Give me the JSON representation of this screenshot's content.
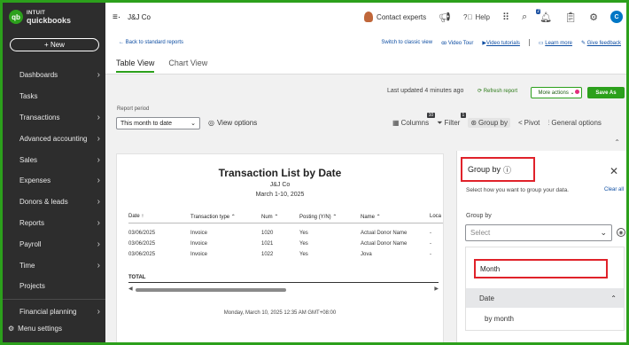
{
  "logo": {
    "badge": "qb",
    "line1": "INTUIT",
    "line2": "quickbooks"
  },
  "new_button": "+ New",
  "sidebar": {
    "items": [
      {
        "label": "Dashboards",
        "chev": true
      },
      {
        "label": "Tasks",
        "chev": false
      },
      {
        "label": "Transactions",
        "chev": true
      },
      {
        "label": "Advanced accounting",
        "chev": true
      },
      {
        "label": "Sales",
        "chev": true
      },
      {
        "label": "Expenses",
        "chev": true
      },
      {
        "label": "Donors & leads",
        "chev": true
      },
      {
        "label": "Reports",
        "chev": true
      },
      {
        "label": "Payroll",
        "chev": true
      },
      {
        "label": "Time",
        "chev": true
      },
      {
        "label": "Projects",
        "chev": false
      },
      {
        "label": "Financial planning",
        "chev": true
      }
    ],
    "menu_settings": "Menu settings"
  },
  "topbar": {
    "company": "J&J Co",
    "contact": "Contact experts",
    "help": "Help",
    "notif_count": "2",
    "user_initial": "C"
  },
  "links": {
    "back": "← Back to standard reports",
    "classic": "Switch to classic view",
    "video_tour": "Video Tour",
    "video_tutorials": "Video tutorials",
    "learn_more": "Learn more",
    "give_feedback": "Give feedback"
  },
  "tabs": [
    "Table View",
    "Chart View"
  ],
  "toolbar": {
    "updated": "Last updated 4 minutes ago",
    "refresh": "Refresh report",
    "more_actions": "More actions ⌄",
    "save_as": "Save As",
    "report_period_label": "Report period",
    "report_period_value": "This month to date",
    "view_options": "View options",
    "columns": "Columns",
    "columns_count": "10",
    "filter": "Filter",
    "filter_count": "1",
    "group_by": "Group by",
    "pivot": "Pivot",
    "general_options": "General options"
  },
  "report": {
    "title": "Transaction List by Date",
    "company": "J&J Co",
    "date_range": "March 1-10, 2025",
    "columns": [
      "Date ↑",
      "Transaction type ⌃",
      "Num ⌃",
      "Posting (Y/N) ⌃",
      "Name ⌃",
      "Loca"
    ],
    "rows": [
      [
        "03/06/2025",
        "Invoice",
        "1020",
        "Yes",
        "Actual Donor Name",
        "-"
      ],
      [
        "03/06/2025",
        "Invoice",
        "1021",
        "Yes",
        "Actual Donor Name",
        "-"
      ],
      [
        "03/06/2025",
        "Invoice",
        "1022",
        "Yes",
        "Jova",
        "-"
      ]
    ],
    "total_label": "TOTAL",
    "footer": "Monday, March 10, 2025 12:35 AM GMT+08:00"
  },
  "group_by_panel": {
    "title": "Group by",
    "description": "Select how you want to group your data.",
    "clear_all": "Clear all",
    "label": "Group by",
    "placeholder": "Select",
    "search_value": "Month",
    "section": "Date",
    "option": "by month"
  },
  "colors": {
    "brand_green": "#2ca01c",
    "sidebar_bg": "#2d2d2d",
    "highlight_red": "#e0222a",
    "link_blue": "#0d4da2"
  }
}
